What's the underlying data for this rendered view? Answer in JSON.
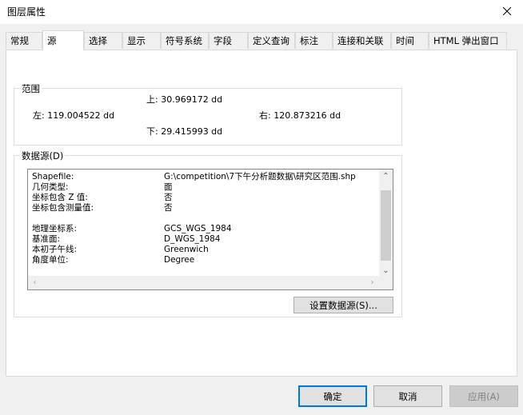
{
  "window": {
    "title": "图层属性"
  },
  "tabs": [
    {
      "label": "常规"
    },
    {
      "label": "源"
    },
    {
      "label": "选择"
    },
    {
      "label": "显示"
    },
    {
      "label": "符号系统"
    },
    {
      "label": "字段"
    },
    {
      "label": "定义查询"
    },
    {
      "label": "标注"
    },
    {
      "label": "连接和关联"
    },
    {
      "label": "时间"
    },
    {
      "label": "HTML 弹出窗口"
    }
  ],
  "extent": {
    "title": "范围",
    "top": "上:  30.969172 dd",
    "left": "左: 119.004522 dd",
    "right": "右:  120.873216 dd",
    "bottom": "下:  29.415993 dd"
  },
  "datasource": {
    "title": "数据源(D)",
    "rows": [
      {
        "key": "Shapefile:",
        "value": "G:\\competition\\7下午分析题数据\\研究区范围.shp"
      },
      {
        "key": "几何类型:",
        "value": "面"
      },
      {
        "key": "坐标包含 Z 值:",
        "value": "否"
      },
      {
        "key": "坐标包含测量值:",
        "value": "否"
      },
      {
        "key": "",
        "value": ""
      },
      {
        "key": "地理坐标系:",
        "value": "GCS_WGS_1984"
      },
      {
        "key": "基准面:",
        "value": "D_WGS_1984"
      },
      {
        "key": "本初子午线:",
        "value": "Greenwich"
      },
      {
        "key": "角度单位:",
        "value": "Degree"
      }
    ],
    "set_button": "设置数据源(S)..."
  },
  "footer": {
    "ok": "确定",
    "cancel": "取消",
    "apply": "应用(A)"
  }
}
